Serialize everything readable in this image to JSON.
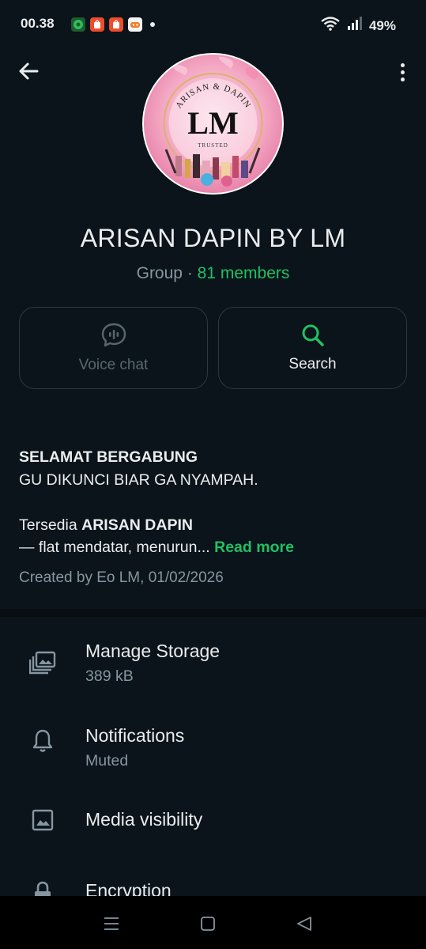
{
  "status_bar": {
    "time": "00.38",
    "battery": "49%",
    "notification_icons": [
      "app-notification-icon",
      "shopee-icon",
      "shopee-icon",
      "game-icon"
    ]
  },
  "header": {
    "back_icon": "back-arrow-icon",
    "more_icon": "more-vertical-icon"
  },
  "group": {
    "avatar": {
      "arc_text": "ARISAN & DAPIN",
      "logo_text": "LM",
      "tagline": "TRUSTED"
    },
    "name": "ARISAN DAPIN BY LM",
    "type": "Group",
    "separator": " · ",
    "members": "81 members"
  },
  "actions": [
    {
      "label": "Voice chat",
      "icon": "voice-chat-icon",
      "enabled": false
    },
    {
      "label": "Search",
      "icon": "search-icon",
      "enabled": true
    }
  ],
  "description": {
    "line1_bold": "SELAMAT BERGABUNG",
    "line2": "GU DIKUNCI BIAR GA NYAMPAH.",
    "line3_prefix": "Tersedia ",
    "line3_bold": "ARISAN DAPIN",
    "line4": "— flat mendatar, menurun...",
    "read_more": "Read more",
    "created": "Created by Eo LM, 01/02/2026"
  },
  "menu": [
    {
      "title": "Manage Storage",
      "subtitle": "389 kB",
      "icon": "storage-icon"
    },
    {
      "title": "Notifications",
      "subtitle": "Muted",
      "icon": "bell-icon"
    },
    {
      "title": "Media visibility",
      "subtitle": "",
      "icon": "image-icon"
    },
    {
      "title": "Encryption",
      "subtitle": "",
      "icon": "lock-icon"
    }
  ],
  "nav": {
    "recents_icon": "recents-icon",
    "home_icon": "home-icon",
    "back_icon": "nav-back-icon"
  },
  "colors": {
    "background": "#0b141a",
    "accent_green": "#21c063",
    "secondary_text": "#8696a0",
    "primary_text": "#e9edef"
  }
}
